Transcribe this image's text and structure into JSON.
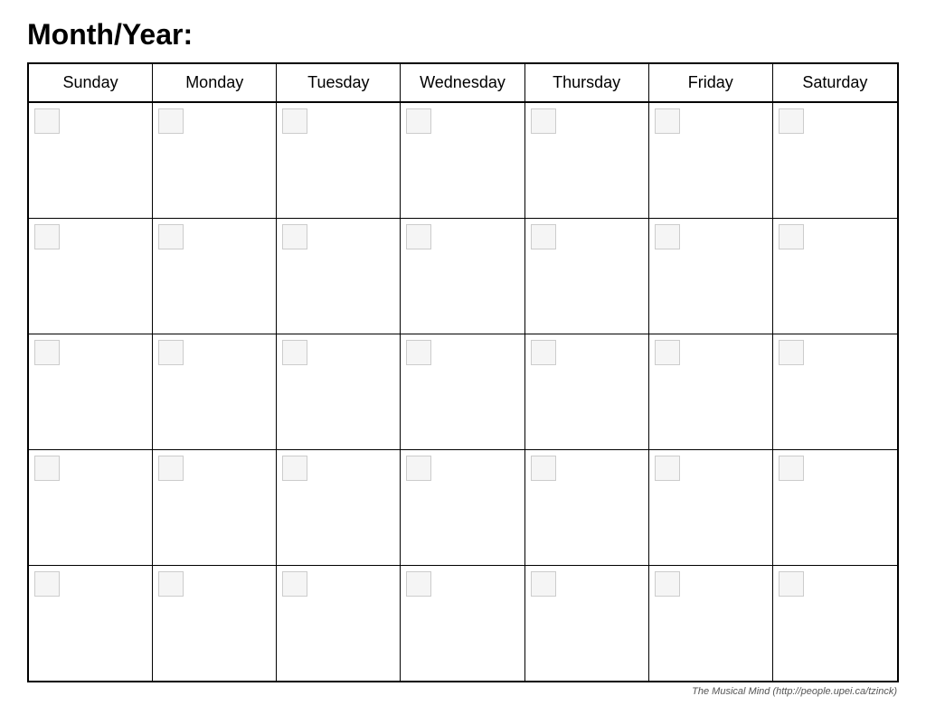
{
  "header": {
    "title": "Month/Year:"
  },
  "days": [
    {
      "label": "Sunday"
    },
    {
      "label": "Monday"
    },
    {
      "label": "Tuesday"
    },
    {
      "label": "Wednesday"
    },
    {
      "label": "Thursday"
    },
    {
      "label": "Friday"
    },
    {
      "label": "Saturday"
    }
  ],
  "rows": [
    {
      "id": "row1"
    },
    {
      "id": "row2"
    },
    {
      "id": "row3"
    },
    {
      "id": "row4"
    },
    {
      "id": "row5"
    }
  ],
  "footer": {
    "text": "The Musical Mind  (http://people.upei.ca/tzinck)"
  }
}
